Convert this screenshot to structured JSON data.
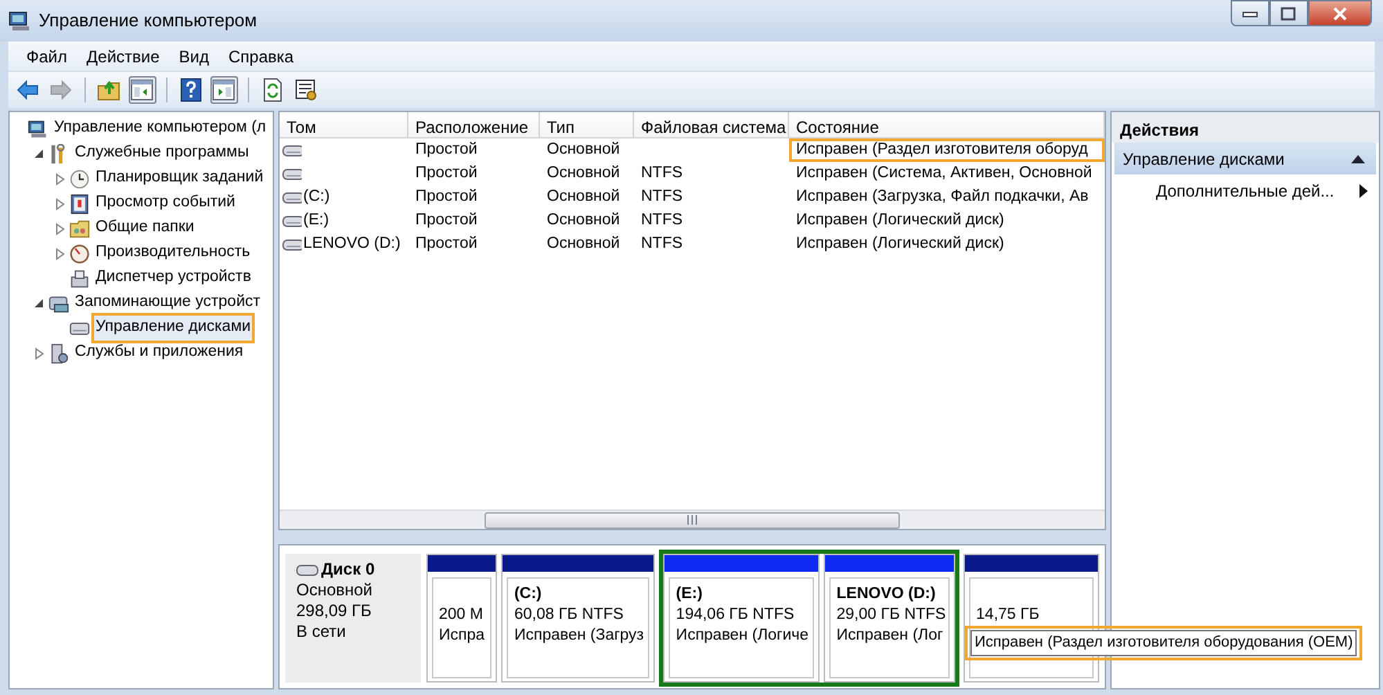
{
  "window": {
    "title": "Управление компьютером"
  },
  "menu": [
    "Файл",
    "Действие",
    "Вид",
    "Справка"
  ],
  "toolbar": [
    {
      "kind": "back",
      "disabled": false,
      "pressed": false
    },
    {
      "kind": "forward",
      "disabled": true,
      "pressed": false
    },
    {
      "kind": "up",
      "disabled": false,
      "pressed": false
    },
    {
      "kind": "tree",
      "disabled": false,
      "pressed": true
    },
    {
      "kind": "help",
      "disabled": false,
      "pressed": false
    },
    {
      "kind": "actions",
      "disabled": false,
      "pressed": true
    },
    {
      "kind": "refresh",
      "disabled": false,
      "pressed": false
    },
    {
      "kind": "properties",
      "disabled": false,
      "pressed": false
    }
  ],
  "tree": [
    {
      "label": "Управление компьютером (л",
      "kind": "computer",
      "selected": false,
      "highlighted": false,
      "children": [
        {
          "label": "Служебные программы",
          "kind": "tools",
          "expanded": true,
          "selected": false,
          "highlighted": false,
          "children": [
            {
              "label": "Планировщик заданий",
              "kind": "clock",
              "expanded": false,
              "selected": false,
              "highlighted": false
            },
            {
              "label": "Просмотр событий",
              "kind": "events",
              "expanded": false,
              "selected": false,
              "highlighted": false
            },
            {
              "label": "Общие папки",
              "kind": "folder",
              "expanded": false,
              "selected": false,
              "highlighted": false
            },
            {
              "label": "Производительность",
              "kind": "gauge",
              "expanded": false,
              "selected": false,
              "highlighted": false
            },
            {
              "label": "Диспетчер устройств",
              "kind": "devices",
              "selected": false,
              "highlighted": false
            }
          ]
        },
        {
          "label": "Запоминающие устройст",
          "kind": "storage",
          "expanded": true,
          "selected": false,
          "highlighted": false,
          "children": [
            {
              "label": "Управление дисками",
              "kind": "disk",
              "selected": true,
              "highlighted": true
            }
          ]
        },
        {
          "label": "Службы и приложения",
          "kind": "services",
          "expanded": false,
          "selected": false,
          "highlighted": false
        }
      ]
    }
  ],
  "table": {
    "columns": [
      "Том",
      "Расположение",
      "Тип",
      "Файловая система",
      "Состояние"
    ],
    "rows": [
      {
        "cells": [
          "",
          "Простой",
          "Основной",
          "",
          "Исправен (Раздел изготовителя оборуд"
        ],
        "highlighted": true
      },
      {
        "cells": [
          "",
          "Простой",
          "Основной",
          "NTFS",
          "Исправен (Система, Активен, Основной"
        ],
        "highlighted": false
      },
      {
        "cells": [
          "(C:)",
          "Простой",
          "Основной",
          "NTFS",
          "Исправен (Загрузка, Файл подкачки, Ав"
        ],
        "highlighted": false
      },
      {
        "cells": [
          "(E:)",
          "Простой",
          "Основной",
          "NTFS",
          "Исправен (Логический диск)"
        ],
        "highlighted": false
      },
      {
        "cells": [
          "LENOVO (D:)",
          "Простой",
          "Основной",
          "NTFS",
          "Исправен (Логический диск)"
        ],
        "highlighted": false
      }
    ]
  },
  "disk": {
    "name": "Диск 0",
    "type": "Основной",
    "size": "298,09 ГБ",
    "status": "В сети",
    "partitions": [
      {
        "kind": "primary",
        "size": "200 М",
        "status": "Испра",
        "highlighted": false
      },
      {
        "kind": "primary",
        "label": "(C:)",
        "size": "60,08 ГБ NTFS",
        "status": "Исправен (Загруз",
        "highlighted": false
      },
      {
        "kind": "logical",
        "label": "(E:)",
        "size": "194,06 ГБ NTFS",
        "status": "Исправен (Логиче",
        "highlighted": true
      },
      {
        "kind": "logical",
        "label": "LENOVO  (D:)",
        "size": "29,00 ГБ NTFS",
        "status": "Исправен (Лог",
        "highlighted": true
      },
      {
        "kind": "primary",
        "size": "14,75 ГБ",
        "highlighted": false
      }
    ]
  },
  "tooltip": {
    "text": "Исправен (Раздел изготовителя оборудования (OEM)",
    "highlighted": true
  },
  "actions": {
    "title": "Действия",
    "items": [
      {
        "kind": "section",
        "label": "Управление дисками",
        "expanded": true
      },
      {
        "kind": "submenu",
        "label": "Дополнительные дей..."
      }
    ]
  }
}
